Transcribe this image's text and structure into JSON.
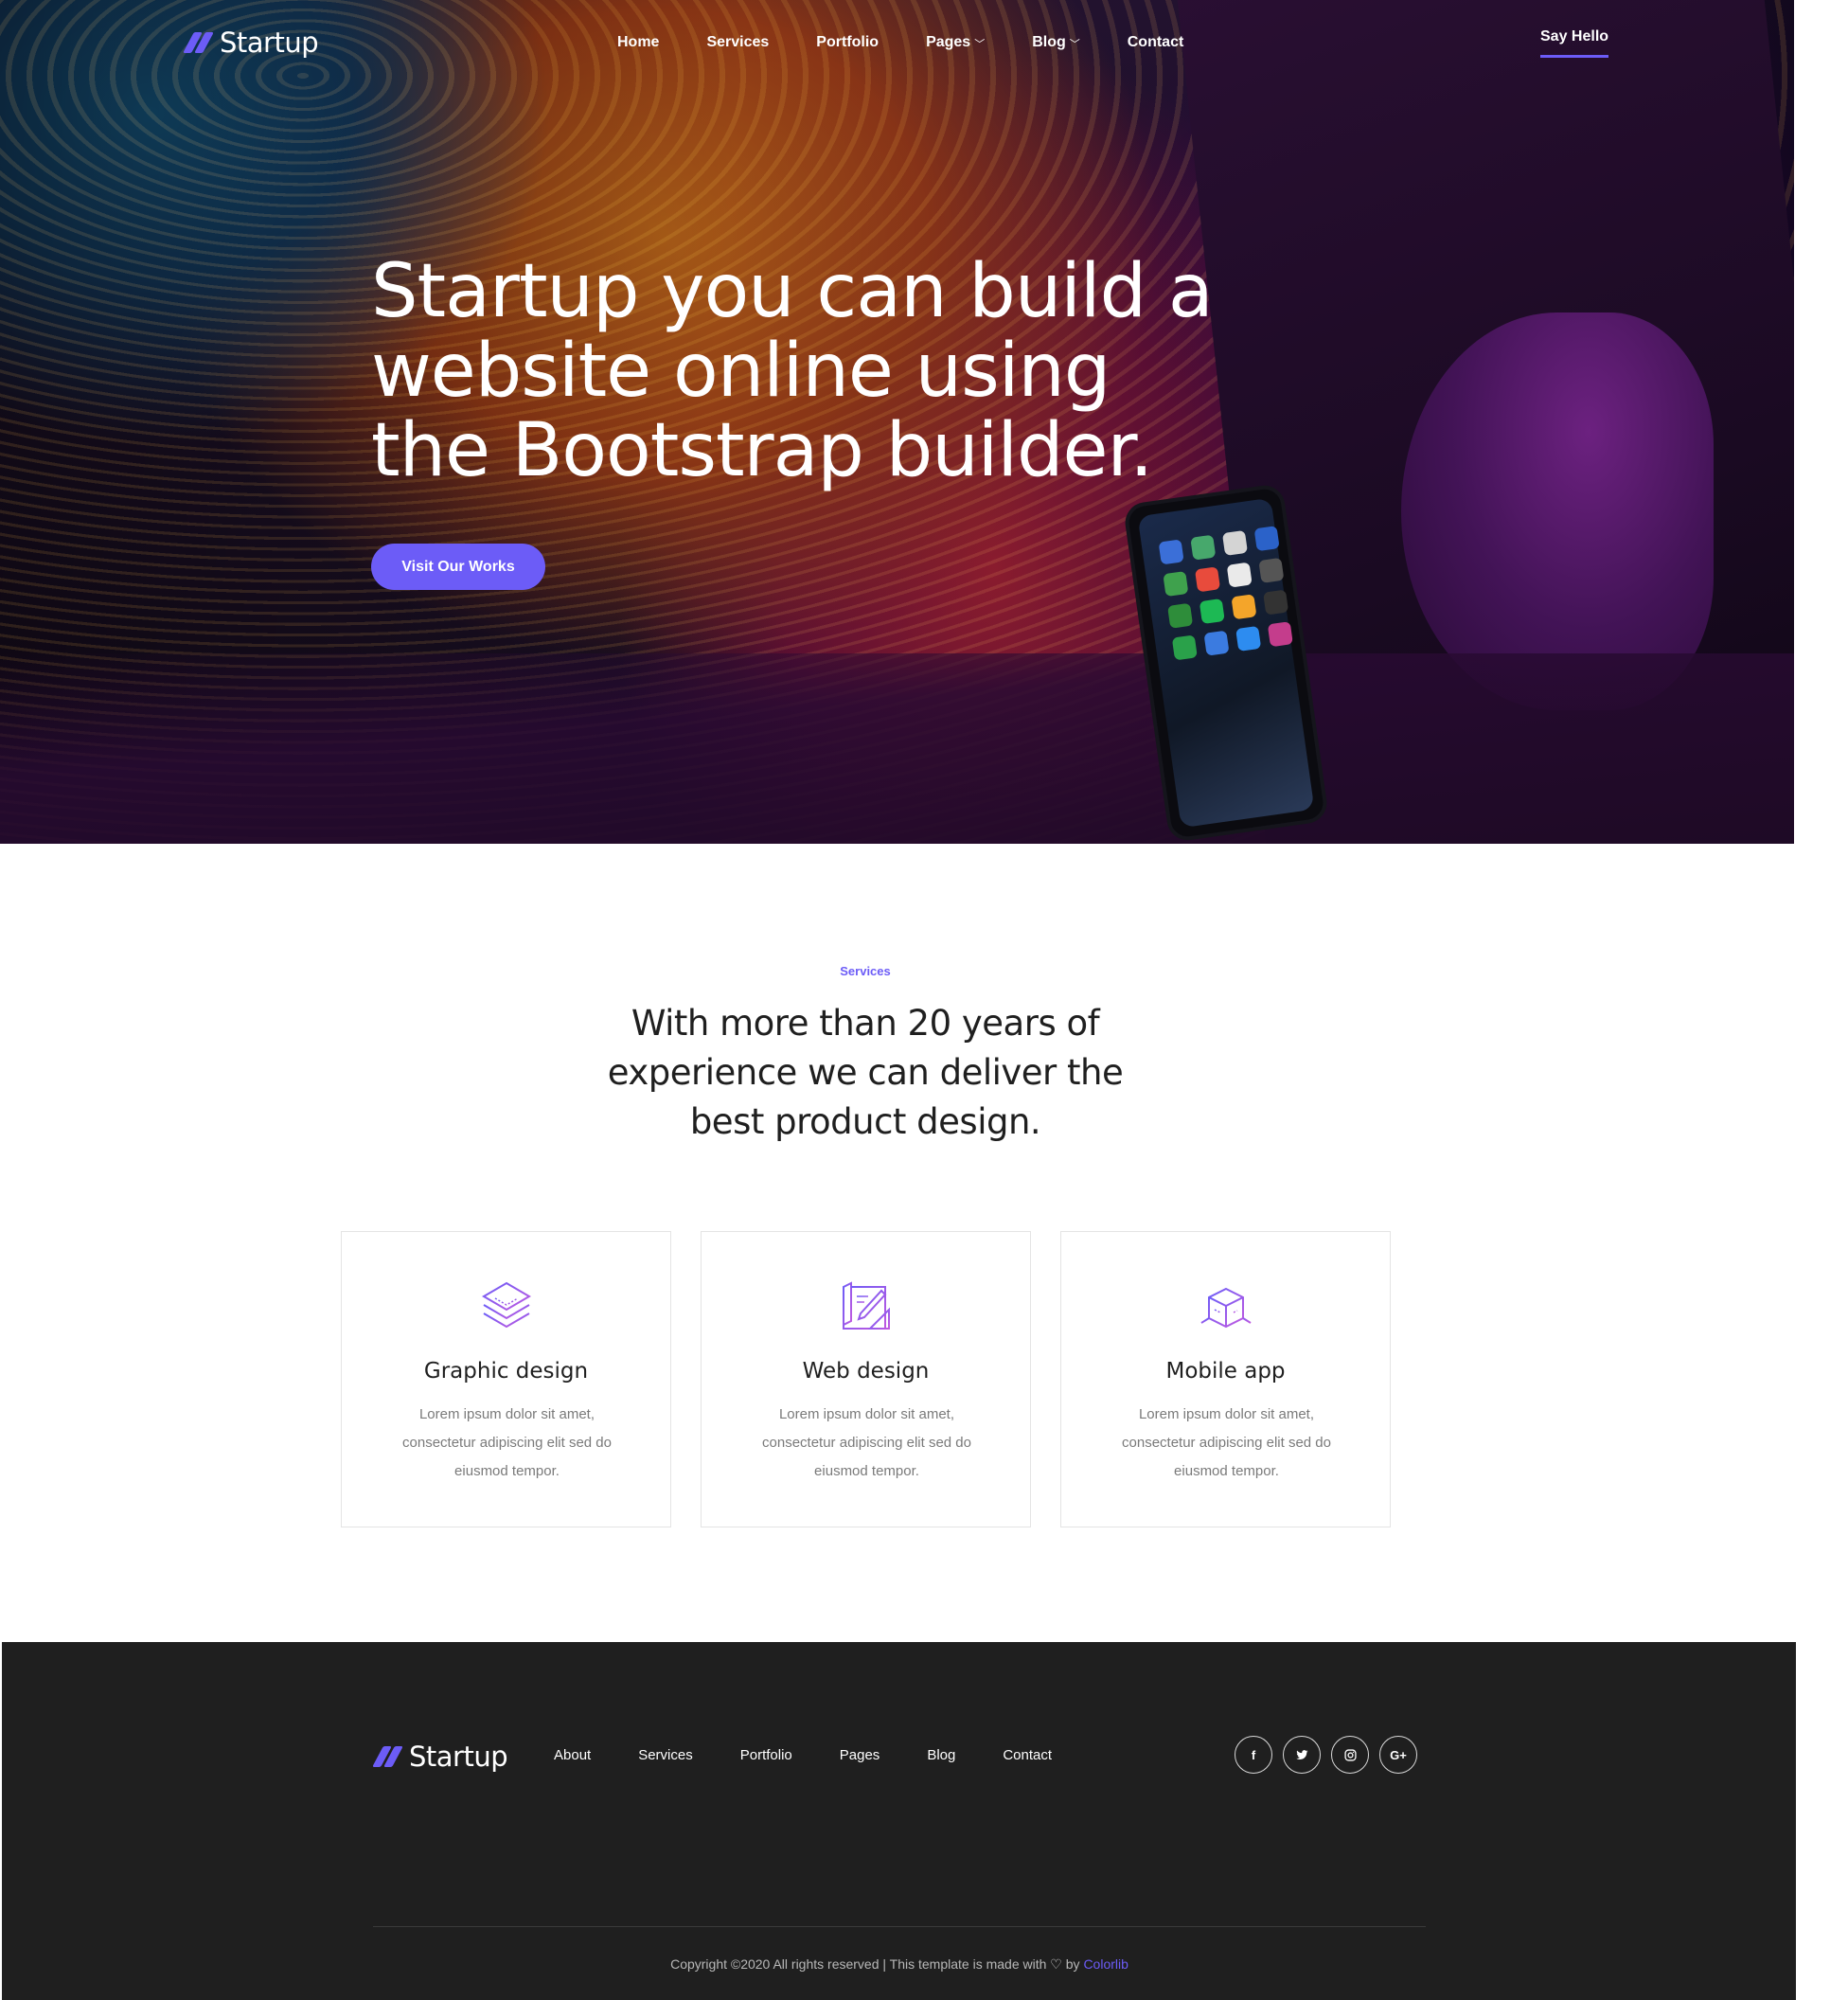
{
  "header": {
    "logo_text": "Startup",
    "nav": [
      {
        "label": "Home",
        "has_dropdown": false
      },
      {
        "label": "Services",
        "has_dropdown": false
      },
      {
        "label": "Portfolio",
        "has_dropdown": false
      },
      {
        "label": "Pages",
        "has_dropdown": true
      },
      {
        "label": "Blog",
        "has_dropdown": true
      },
      {
        "label": "Contact",
        "has_dropdown": false
      }
    ],
    "cta_label": "Say Hello"
  },
  "hero": {
    "title": "Startup you can build a website online using the Bootstrap builder.",
    "button_label": "Visit Our Works"
  },
  "services": {
    "label": "Services",
    "heading": "With more than 20 years of experience we can deliver the best product design.",
    "cards": [
      {
        "icon": "layers-icon",
        "title": "Graphic design",
        "text": "Lorem ipsum dolor sit amet, consectetur adipiscing elit sed do eiusmod tempor."
      },
      {
        "icon": "blueprint-icon",
        "title": "Web design",
        "text": "Lorem ipsum dolor sit amet, consectetur adipiscing elit sed do eiusmod tempor."
      },
      {
        "icon": "cube-icon",
        "title": "Mobile app",
        "text": "Lorem ipsum dolor sit amet, consectetur adipiscing elit sed do eiusmod tempor."
      }
    ]
  },
  "footer": {
    "logo_text": "Startup",
    "nav": [
      "About",
      "Services",
      "Portfolio",
      "Pages",
      "Blog",
      "Contact"
    ],
    "socials": [
      {
        "icon": "facebook-icon",
        "glyph": "f"
      },
      {
        "icon": "twitter-icon",
        "glyph": "t"
      },
      {
        "icon": "instagram-icon",
        "glyph": "◎"
      },
      {
        "icon": "google-plus-icon",
        "glyph": "G+"
      }
    ],
    "copyright_prefix": "Copyright ©2020 All rights reserved | This template is made with",
    "copyright_by": "by",
    "copyright_brand": "Colorlib"
  },
  "colors": {
    "accent": "#6c5cf7",
    "footer_bg": "#1f1f1f",
    "text_dark": "#1f1f1f",
    "text_muted": "#7a7a7a"
  }
}
